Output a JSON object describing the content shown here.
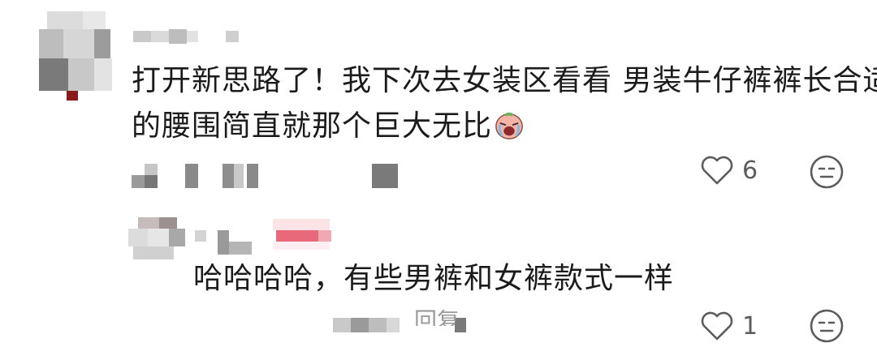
{
  "comments": [
    {
      "text_line1": "打开新思路了！我下次去女装区看看 男装牛仔裤裤长合适",
      "text_line2": "的腰围简直就那个巨大无比",
      "emoji": "crying-face-emoji",
      "like_count": "6"
    },
    {
      "text": "哈哈哈哈，有些男裤和女裤款式一样",
      "like_count": "1",
      "reply_label": "回复"
    }
  ],
  "icons": {
    "like": "heart-outline-icon",
    "dislike": "neutral-face-icon"
  },
  "colors": {
    "text": "#1b1b1b",
    "icon": "#5c5c5c",
    "mosaic_gray": "#8a8a8a",
    "mosaic_pink": "#e86a7a"
  }
}
